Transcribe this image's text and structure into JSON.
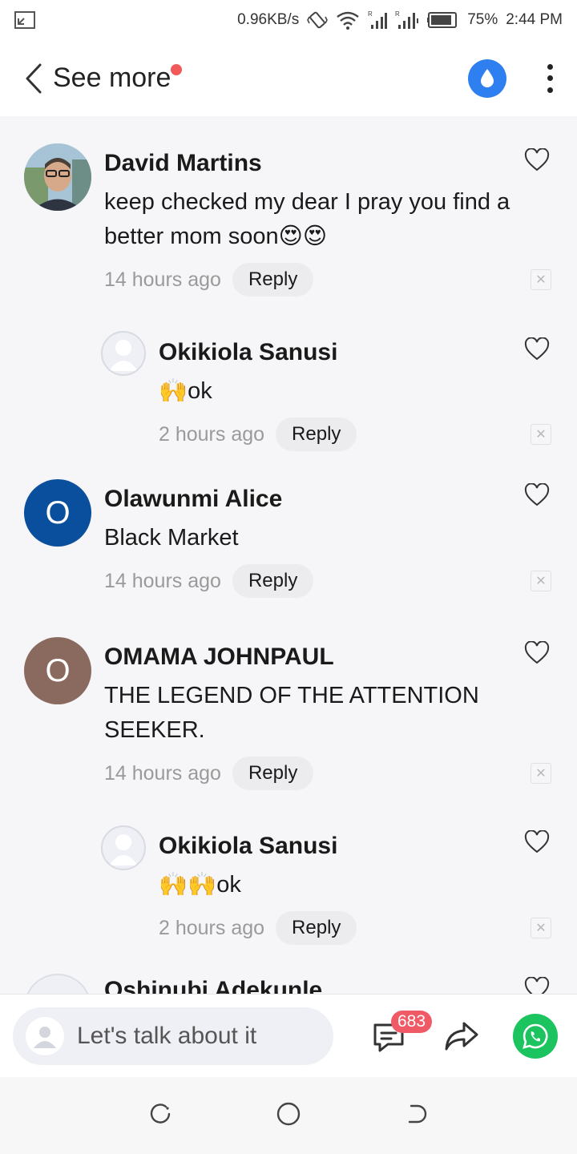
{
  "status_bar": {
    "speed": "0.96KB/s",
    "battery": "75%",
    "time": "2:44 PM",
    "icons": [
      "screen-icon",
      "vibrate-icon",
      "wifi-icon",
      "signal-icon",
      "signal-icon",
      "battery-icon"
    ]
  },
  "header": {
    "back_label": "See more",
    "has_notification_dot": true,
    "accent": "#2e7ff0"
  },
  "comments": [
    {
      "name": "David Martins",
      "text": "keep checked my dear I pray you find a better mom soon😍😍",
      "time": "14 hours ago",
      "reply_label": "Reply",
      "avatar": "photo",
      "is_reply": false
    },
    {
      "name": "Okikiola Sanusi",
      "text": "🙌ok",
      "time": "2 hours ago",
      "reply_label": "Reply",
      "avatar": "placeholder",
      "is_reply": true
    },
    {
      "name": "Olawunmi Alice",
      "text": "Black Market",
      "time": "14 hours ago",
      "reply_label": "Reply",
      "avatar_letter": "O",
      "avatar_color": "#0a4f9e",
      "is_reply": false
    },
    {
      "name": "OMAMA JOHNPAUL",
      "text": "THE LEGEND OF THE ATTENTION SEEKER.",
      "time": "14 hours ago",
      "reply_label": "Reply",
      "avatar_letter": "O",
      "avatar_color": "#8a6a5e",
      "is_reply": false
    },
    {
      "name": "Okikiola Sanusi",
      "text": "🙌🙌ok",
      "time": "2 hours ago",
      "reply_label": "Reply",
      "avatar": "placeholder",
      "is_reply": true
    },
    {
      "name": "Oshinubi Adekunle",
      "avatar": "placeholder",
      "is_reply": false
    }
  ],
  "bottom_bar": {
    "input_placeholder": "Let's talk about it",
    "comment_count": "683",
    "whatsapp_color": "#1bc45f"
  },
  "nav_bar": {
    "buttons": [
      "recent-apps-icon",
      "home-icon",
      "back-icon"
    ]
  }
}
